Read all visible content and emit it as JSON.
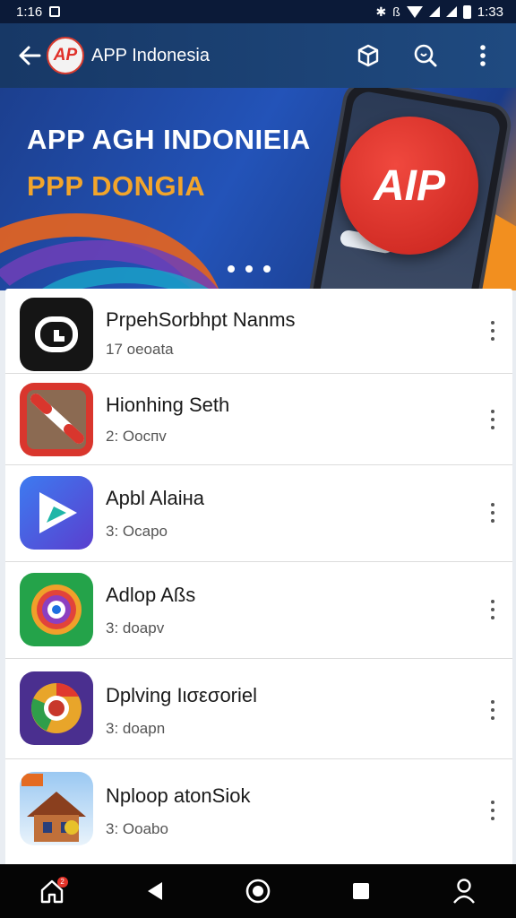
{
  "status_bar": {
    "time": "1:16",
    "right_time": "1:33",
    "icons": [
      "notification-icon",
      "bluetooth-icon",
      "vibrate-icon",
      "wifi-icon",
      "signal-icon",
      "signal-icon",
      "battery-icon"
    ]
  },
  "app_bar": {
    "title": "APP Indonesia",
    "logo_text": "AP",
    "icons": [
      "back-arrow-icon",
      "cube-icon",
      "search-icon",
      "more-vert-icon"
    ]
  },
  "banner": {
    "title_line1": "APP AGH INDONIEIA",
    "title_line2": "PPP DONGIA",
    "logo_text": "AIP",
    "carousel_dots": 3,
    "colors": {
      "title_line1": "#ffffff",
      "title_line2": "#f2a52b",
      "logo_red": "#d9302a"
    }
  },
  "apps": [
    {
      "name": "PrpehSorbhpt Nanms",
      "sub": "17 oeoata",
      "icon": "timer-app-icon"
    },
    {
      "name": "Hionhing Seth",
      "sub": "2: Ooспv",
      "icon": "pen-app-icon"
    },
    {
      "name": "Apbl Alaiна",
      "sub": "3: Ocapo",
      "icon": "play-arrow-app-icon"
    },
    {
      "name": "Adlop Aßs",
      "sub": "3: doapv",
      "icon": "color-ring-app-icon"
    },
    {
      "name": "Dplving Ιισεσοriel",
      "sub": "3: doapn",
      "icon": "chrome-like-app-icon"
    },
    {
      "name": "Nploop atonSiok",
      "sub": "3: Ooabo",
      "icon": "house-app-icon"
    }
  ],
  "nav_bar": {
    "icons": [
      "home-icon",
      "back-triangle-icon",
      "assistant-icon",
      "recents-square-icon",
      "profile-icon"
    ],
    "home_badge": "2"
  }
}
